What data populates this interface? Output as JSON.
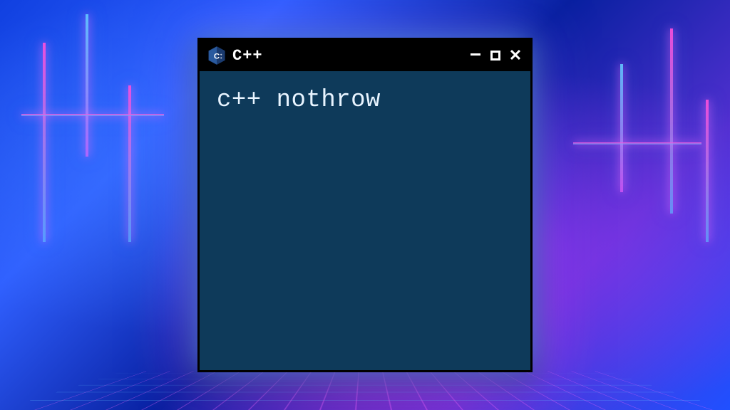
{
  "window": {
    "title": "C++",
    "content_text": "c++ nothrow"
  },
  "icons": {
    "app": "cpp-logo-icon",
    "minimize": "minimize-icon",
    "maximize": "maximize-icon",
    "close": "close-icon"
  },
  "colors": {
    "titlebar_bg": "#000000",
    "content_bg": "#0e3a5a",
    "text": "#e8f4ff"
  }
}
